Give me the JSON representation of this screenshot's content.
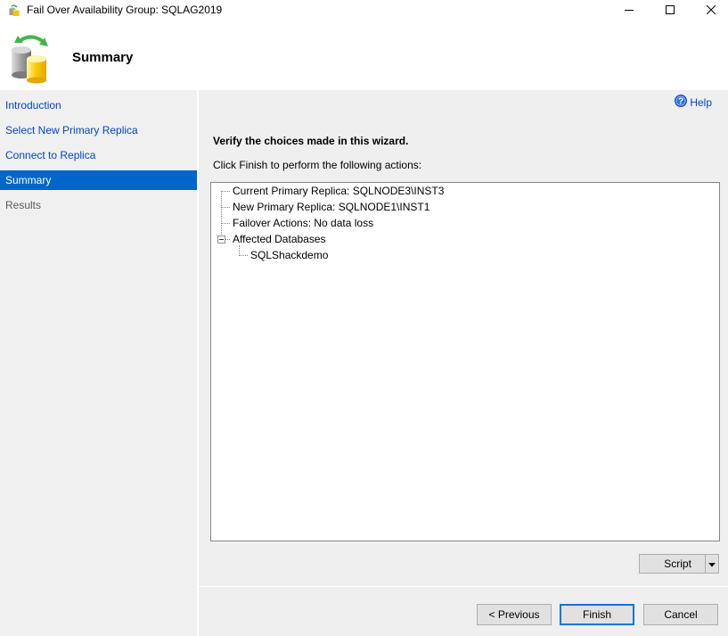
{
  "window": {
    "title": "Fail Over Availability Group: SQLAG2019",
    "app_icon": "database-failover-icon",
    "controls": [
      "minimize",
      "maximize",
      "close"
    ]
  },
  "header": {
    "title": "Summary",
    "icon": "database-failover-icon"
  },
  "sidebar": {
    "items": [
      {
        "label": "Introduction",
        "state": "link"
      },
      {
        "label": "Select New Primary Replica",
        "state": "link"
      },
      {
        "label": "Connect to Replica",
        "state": "link"
      },
      {
        "label": "Summary",
        "state": "active"
      },
      {
        "label": "Results",
        "state": "disabled"
      }
    ]
  },
  "main": {
    "help_label": "Help",
    "heading": "Verify the choices made in this wizard.",
    "instructions": "Click Finish to perform the following actions:",
    "tree": {
      "nodes": [
        {
          "label": "Current Primary Replica: SQLNODE3\\INST3",
          "level": 0
        },
        {
          "label": "New Primary Replica: SQLNODE1\\INST1",
          "level": 0
        },
        {
          "label": "Failover Actions: No data loss",
          "level": 0
        },
        {
          "label": "Affected Databases",
          "level": 0,
          "expanded": true
        },
        {
          "label": "SQLShackdemo",
          "level": 1
        }
      ]
    },
    "script_label": "Script"
  },
  "footer": {
    "previous_label": "< Previous",
    "finish_label": "Finish",
    "cancel_label": "Cancel"
  },
  "colors": {
    "accent": "#0066cc",
    "link": "#0046c7",
    "focus_border": "#0078d7"
  }
}
